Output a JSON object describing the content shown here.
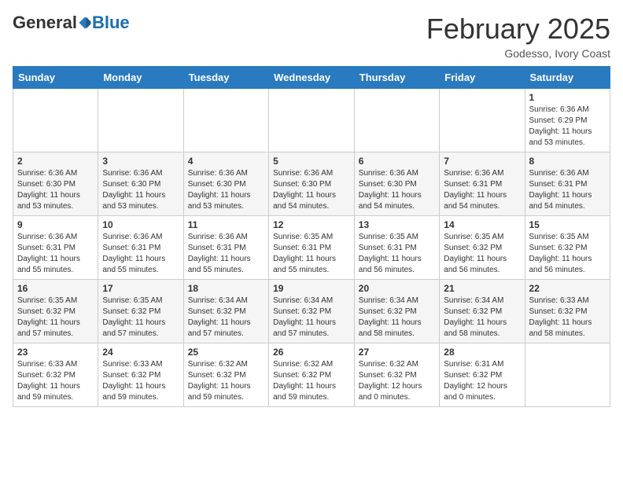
{
  "header": {
    "logo_general": "General",
    "logo_blue": "Blue",
    "month_title": "February 2025",
    "location": "Godesso, Ivory Coast"
  },
  "calendar": {
    "days_of_week": [
      "Sunday",
      "Monday",
      "Tuesday",
      "Wednesday",
      "Thursday",
      "Friday",
      "Saturday"
    ],
    "weeks": [
      [
        {
          "day": "",
          "info": ""
        },
        {
          "day": "",
          "info": ""
        },
        {
          "day": "",
          "info": ""
        },
        {
          "day": "",
          "info": ""
        },
        {
          "day": "",
          "info": ""
        },
        {
          "day": "",
          "info": ""
        },
        {
          "day": "1",
          "info": "Sunrise: 6:36 AM\nSunset: 6:29 PM\nDaylight: 11 hours\nand 53 minutes."
        }
      ],
      [
        {
          "day": "2",
          "info": "Sunrise: 6:36 AM\nSunset: 6:30 PM\nDaylight: 11 hours\nand 53 minutes."
        },
        {
          "day": "3",
          "info": "Sunrise: 6:36 AM\nSunset: 6:30 PM\nDaylight: 11 hours\nand 53 minutes."
        },
        {
          "day": "4",
          "info": "Sunrise: 6:36 AM\nSunset: 6:30 PM\nDaylight: 11 hours\nand 53 minutes."
        },
        {
          "day": "5",
          "info": "Sunrise: 6:36 AM\nSunset: 6:30 PM\nDaylight: 11 hours\nand 54 minutes."
        },
        {
          "day": "6",
          "info": "Sunrise: 6:36 AM\nSunset: 6:30 PM\nDaylight: 11 hours\nand 54 minutes."
        },
        {
          "day": "7",
          "info": "Sunrise: 6:36 AM\nSunset: 6:31 PM\nDaylight: 11 hours\nand 54 minutes."
        },
        {
          "day": "8",
          "info": "Sunrise: 6:36 AM\nSunset: 6:31 PM\nDaylight: 11 hours\nand 54 minutes."
        }
      ],
      [
        {
          "day": "9",
          "info": "Sunrise: 6:36 AM\nSunset: 6:31 PM\nDaylight: 11 hours\nand 55 minutes."
        },
        {
          "day": "10",
          "info": "Sunrise: 6:36 AM\nSunset: 6:31 PM\nDaylight: 11 hours\nand 55 minutes."
        },
        {
          "day": "11",
          "info": "Sunrise: 6:36 AM\nSunset: 6:31 PM\nDaylight: 11 hours\nand 55 minutes."
        },
        {
          "day": "12",
          "info": "Sunrise: 6:35 AM\nSunset: 6:31 PM\nDaylight: 11 hours\nand 55 minutes."
        },
        {
          "day": "13",
          "info": "Sunrise: 6:35 AM\nSunset: 6:31 PM\nDaylight: 11 hours\nand 56 minutes."
        },
        {
          "day": "14",
          "info": "Sunrise: 6:35 AM\nSunset: 6:32 PM\nDaylight: 11 hours\nand 56 minutes."
        },
        {
          "day": "15",
          "info": "Sunrise: 6:35 AM\nSunset: 6:32 PM\nDaylight: 11 hours\nand 56 minutes."
        }
      ],
      [
        {
          "day": "16",
          "info": "Sunrise: 6:35 AM\nSunset: 6:32 PM\nDaylight: 11 hours\nand 57 minutes."
        },
        {
          "day": "17",
          "info": "Sunrise: 6:35 AM\nSunset: 6:32 PM\nDaylight: 11 hours\nand 57 minutes."
        },
        {
          "day": "18",
          "info": "Sunrise: 6:34 AM\nSunset: 6:32 PM\nDaylight: 11 hours\nand 57 minutes."
        },
        {
          "day": "19",
          "info": "Sunrise: 6:34 AM\nSunset: 6:32 PM\nDaylight: 11 hours\nand 57 minutes."
        },
        {
          "day": "20",
          "info": "Sunrise: 6:34 AM\nSunset: 6:32 PM\nDaylight: 11 hours\nand 58 minutes."
        },
        {
          "day": "21",
          "info": "Sunrise: 6:34 AM\nSunset: 6:32 PM\nDaylight: 11 hours\nand 58 minutes."
        },
        {
          "day": "22",
          "info": "Sunrise: 6:33 AM\nSunset: 6:32 PM\nDaylight: 11 hours\nand 58 minutes."
        }
      ],
      [
        {
          "day": "23",
          "info": "Sunrise: 6:33 AM\nSunset: 6:32 PM\nDaylight: 11 hours\nand 59 minutes."
        },
        {
          "day": "24",
          "info": "Sunrise: 6:33 AM\nSunset: 6:32 PM\nDaylight: 11 hours\nand 59 minutes."
        },
        {
          "day": "25",
          "info": "Sunrise: 6:32 AM\nSunset: 6:32 PM\nDaylight: 11 hours\nand 59 minutes."
        },
        {
          "day": "26",
          "info": "Sunrise: 6:32 AM\nSunset: 6:32 PM\nDaylight: 11 hours\nand 59 minutes."
        },
        {
          "day": "27",
          "info": "Sunrise: 6:32 AM\nSunset: 6:32 PM\nDaylight: 12 hours\nand 0 minutes."
        },
        {
          "day": "28",
          "info": "Sunrise: 6:31 AM\nSunset: 6:32 PM\nDaylight: 12 hours\nand 0 minutes."
        },
        {
          "day": "",
          "info": ""
        }
      ]
    ]
  }
}
